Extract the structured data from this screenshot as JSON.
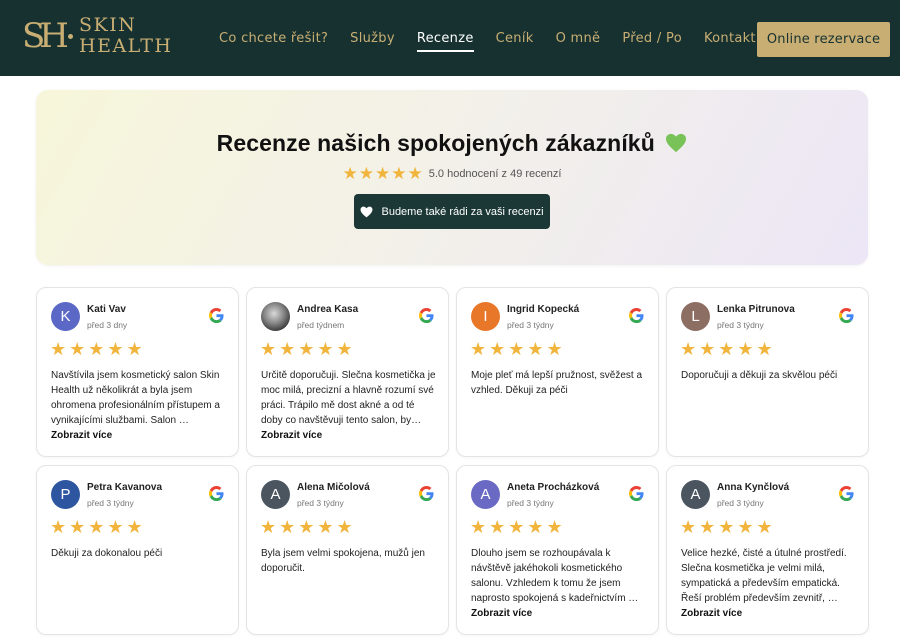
{
  "header": {
    "logo_mark": "SH",
    "logo_line1": "SKIN",
    "logo_line2": "HEALTH",
    "nav": [
      {
        "label": "Co chcete řešit?",
        "active": false
      },
      {
        "label": "Služby",
        "active": false
      },
      {
        "label": "Recenze",
        "active": true
      },
      {
        "label": "Ceník",
        "active": false
      },
      {
        "label": "O mně",
        "active": false
      },
      {
        "label": "Před / Po",
        "active": false
      },
      {
        "label": "Kontakt",
        "active": false
      }
    ],
    "cta_label": "Online rezervace"
  },
  "hero": {
    "title": "Recenze našich spokojených zákazníků",
    "stars": "★★★★★",
    "rating_text": "5.0 hodnocení z 49 recenzí",
    "button_label": "Budeme také rádi za vaši recenzi"
  },
  "colors": {
    "header_bg": "#16312f",
    "gold": "#c9ae74",
    "star": "#f1b43c",
    "button_dark": "#1b3836"
  },
  "reviews": [
    {
      "initial": "K",
      "avatar_color": "#5b68c6",
      "name": "Kati Vav",
      "date": "před 3 dny",
      "stars": "★★★★★",
      "text": "Navštívila jsem kosmetický salon Skin Health už několikrát a byla jsem ohromena profesionálním přístupem a vynikajícími službami. Salon …",
      "more": "Zobrazit více"
    },
    {
      "initial": "",
      "avatar_color": "photo",
      "name": "Andrea Kasa",
      "date": "před týdnem",
      "stars": "★★★★★",
      "text": "Určitě doporučuji. Slečna kosmetička je moc milá, precizní a hlavně rozumí své práci. Trápilo mě dost akné a od té doby co navštěvuji tento salon, by…",
      "more": "Zobrazit více"
    },
    {
      "initial": "I",
      "avatar_color": "#e8772a",
      "name": "Ingrid Kopecká",
      "date": "před 3 týdny",
      "stars": "★★★★★",
      "text": "Moje pleť má lepší pružnost, svěžest a vzhled. Děkuji za péči",
      "more": ""
    },
    {
      "initial": "L",
      "avatar_color": "#8d6e63",
      "name": "Lenka Pitrunova",
      "date": "před 3 týdny",
      "stars": "★★★★★",
      "text": "Doporučuji a děkuji za skvělou péči",
      "more": ""
    },
    {
      "initial": "P",
      "avatar_color": "#2d55a0",
      "name": "Petra Kavanova",
      "date": "před 3 týdny",
      "stars": "★★★★★",
      "text": "Děkuji za dokonalou péči",
      "more": ""
    },
    {
      "initial": "A",
      "avatar_color": "#4a5560",
      "name": "Alena Mičolová",
      "date": "před 3 týdny",
      "stars": "★★★★★",
      "text": "Byla jsem velmi spokojena, mužů jen doporučit.",
      "more": ""
    },
    {
      "initial": "A",
      "avatar_color": "#6a6ac4",
      "name": "Aneta Procházková",
      "date": "před 3 týdny",
      "stars": "★★★★★",
      "text": "Dlouho jsem se rozhoupávala k návštěvě jakéhokoli kosmetického salonu. Vzhledem k tomu že jsem naprosto spokojená s kadeřnictvím …",
      "more": "Zobrazit více"
    },
    {
      "initial": "A",
      "avatar_color": "#4a5560",
      "name": "Anna Kynčlová",
      "date": "před 3 týdny",
      "stars": "★★★★★",
      "text": "Velice hezké, čisté a útulné prostředí. Slečna kosmetička je velmi milá, sympatická a především empatická. Řeší problém především zevnitř, …",
      "more": "Zobrazit více"
    }
  ]
}
